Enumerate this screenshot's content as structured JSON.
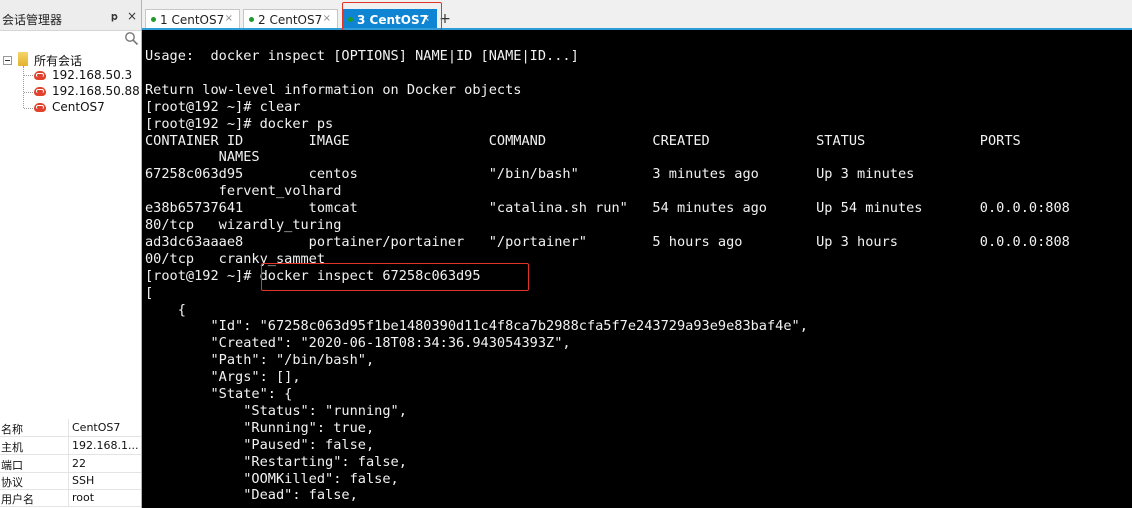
{
  "left_panel": {
    "title": "会话管理器",
    "pin_glyph": "ᵖ",
    "close_glyph": "×",
    "tree": {
      "root_label": "所有会话",
      "sessions": [
        {
          "label": "192.168.50.3"
        },
        {
          "label": "192.168.50.88"
        },
        {
          "label": "CentOS7"
        }
      ]
    },
    "properties": [
      {
        "key": "名称",
        "value": "CentOS7"
      },
      {
        "key": "主机",
        "value": "192.168.1..."
      },
      {
        "key": "端口",
        "value": "22"
      },
      {
        "key": "协议",
        "value": "SSH"
      },
      {
        "key": "用户名",
        "value": "root"
      }
    ]
  },
  "tabs": [
    {
      "label": "1 CentOS7",
      "close": "×",
      "active": false
    },
    {
      "label": "2 CentOS7",
      "close": "×",
      "active": false
    },
    {
      "label": "3 CentOS7",
      "close": "×",
      "active": true
    }
  ],
  "new_tab_glyph": "+",
  "terminal": {
    "lines": [
      "Usage:  docker inspect [OPTIONS] NAME|ID [NAME|ID...]",
      "",
      "Return low-level information on Docker objects",
      "[root@192 ~]# clear",
      "[root@192 ~]# docker ps",
      "CONTAINER ID        IMAGE                 COMMAND             CREATED             STATUS              PORTS",
      "         NAMES",
      "67258c063d95        centos                \"/bin/bash\"         3 minutes ago       Up 3 minutes",
      "         fervent_volhard",
      "e38b65737641        tomcat                \"catalina.sh run\"   54 minutes ago      Up 54 minutes       0.0.0.0:808",
      "80/tcp   wizardly_turing",
      "ad3dc63aaae8        portainer/portainer   \"/portainer\"        5 hours ago         Up 3 hours          0.0.0.0:808",
      "00/tcp   cranky_sammet",
      "[root@192 ~]# docker inspect 67258c063d95",
      "[",
      "    {",
      "        \"Id\": \"67258c063d95f1be1480390d11c4f8ca7b2988cfa5f7e243729a93e9e83baf4e\",",
      "        \"Created\": \"2020-06-18T08:34:36.943054393Z\",",
      "        \"Path\": \"/bin/bash\",",
      "        \"Args\": [],",
      "        \"State\": {",
      "            \"Status\": \"running\",",
      "            \"Running\": true,",
      "            \"Paused\": false,",
      "            \"Restarting\": false,",
      "            \"OOMKilled\": false,",
      "            \"Dead\": false,"
    ]
  },
  "colors": {
    "accent": "#0f84d2",
    "highlight": "#e0352b",
    "terminal_bg": "#000000",
    "terminal_fg": "#f2f2f2"
  },
  "icons": [
    "search-icon",
    "pin-icon",
    "close-icon",
    "collapse-icon",
    "folder-icon",
    "host-icon",
    "new-tab-icon",
    "connected-dot-icon"
  ]
}
